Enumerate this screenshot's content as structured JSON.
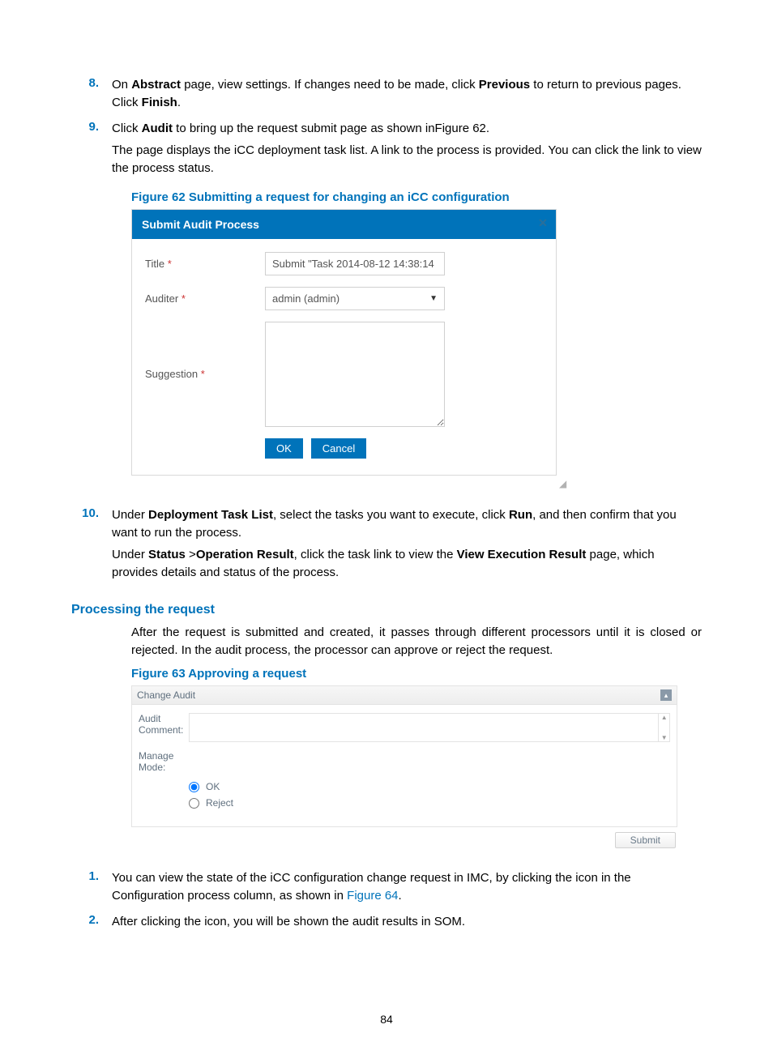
{
  "steps_a": [
    {
      "num": "8.",
      "paras": [
        [
          "On ",
          {
            "b": "Abstract"
          },
          " page, view settings. If changes need to be made, click ",
          {
            "b": "Previous"
          },
          " to return to previous pages. Click ",
          {
            "b": "Finish"
          },
          "."
        ]
      ]
    },
    {
      "num": "9.",
      "paras": [
        [
          "Click ",
          {
            "b": "Audit"
          },
          " to bring up the request submit page as shown inFigure 62."
        ],
        [
          "The page displays the iCC deployment task list. A link to the process is provided. You can click the link to view the process status."
        ]
      ]
    }
  ],
  "figure62_caption": "Figure 62 Submitting a request for changing an iCC configuration",
  "dialog": {
    "title": "Submit Audit Process",
    "title_label": "Title",
    "title_value": "Submit \"Task 2014-08-12 14:38:14",
    "auditer_label": "Auditer",
    "auditer_value": "admin (admin)",
    "suggestion_label": "Suggestion",
    "ok": "OK",
    "cancel": "Cancel"
  },
  "steps_b": [
    {
      "num": "10.",
      "paras": [
        [
          "Under ",
          {
            "b": "Deployment Task List"
          },
          ", select the tasks you want to execute, click ",
          {
            "b": "Run"
          },
          ", and then confirm that you want to run the process."
        ],
        [
          "Under ",
          {
            "b": "Status"
          },
          " >",
          {
            "b": "Operation Result"
          },
          ", click the task link to view the ",
          {
            "b": "View Execution Result"
          },
          " page, which provides details and status of the process."
        ]
      ]
    }
  ],
  "section_h": "Processing the request",
  "processing_para": "After the request is submitted and created, it passes through different processors until it is closed or rejected. In the audit process, the processor can approve or reject the request.",
  "figure63_caption": "Figure 63 Approving a request",
  "panel": {
    "title": "Change Audit",
    "audit_label": "Audit Comment:",
    "manage_label": "Manage Mode:",
    "ok": "OK",
    "reject": "Reject",
    "submit": "Submit"
  },
  "steps_c": [
    {
      "num": "1.",
      "paras": [
        [
          "You can view the state of the iCC configuration change request in IMC, by clicking the icon in the Configuration process column, as shown in ",
          {
            "link": "Figure 64"
          },
          "."
        ]
      ]
    },
    {
      "num": "2.",
      "paras": [
        [
          "After clicking the icon, you will be shown the audit results in SOM."
        ]
      ]
    }
  ],
  "page_number": "84"
}
